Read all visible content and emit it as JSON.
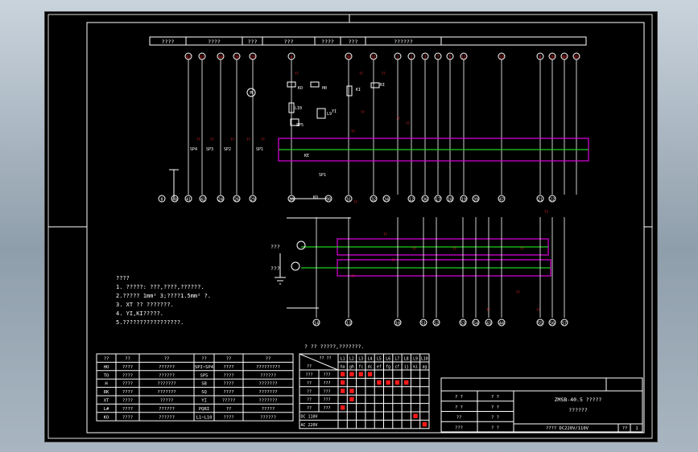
{
  "header_row": [
    "????",
    "????",
    "???",
    "???",
    "????",
    "???",
    "??????"
  ],
  "bus_labels": [
    "42",
    "41",
    "44",
    "26",
    "29",
    "4",
    "30",
    "31",
    "1",
    "2",
    "3",
    "7",
    "5",
    "11",
    "33",
    "6",
    "20",
    "40",
    "45"
  ],
  "terminal_labels": [
    "0",
    "40",
    "41",
    "42",
    "24",
    "26",
    "29",
    "28",
    "30",
    "31",
    "32",
    "34",
    "12",
    "36",
    "17",
    "18",
    "19",
    "39",
    "47",
    "21",
    "22"
  ],
  "bottom_terminals": [
    "14",
    "13",
    "10",
    "51",
    "52",
    "53",
    "54",
    "43",
    "44",
    "55",
    "56",
    "57"
  ],
  "small_labels": {
    "relay_labels": [
      "KO",
      "H0",
      "KI",
      "RI",
      "LI0",
      "L9",
      "SP5",
      "YI",
      "SP4",
      "SP3",
      "SP2",
      "SP1",
      "SP1",
      "KO",
      "KE"
    ],
    "motor": "M",
    "misc_caption": "? ?? ?????,???????.",
    "side_labels": [
      "???",
      "???"
    ]
  },
  "notes": {
    "title": "????",
    "lines": [
      "1. ?????:  ???,????,??????.",
      "2.?????  1mm²  3;????1.5mm²       ?.",
      "3. XT  ??      ???????.",
      "4. YI,KI?????.",
      "5.?????????????????."
    ]
  },
  "legend_table": {
    "header": [
      "??",
      "??",
      "??",
      "??",
      "??",
      "??"
    ],
    "rows": [
      [
        "HO",
        "????",
        "??????",
        "SPI~SP4",
        "????",
        "?????????"
      ],
      [
        "TO",
        "????",
        "??????",
        "SP5",
        "????",
        "??????"
      ],
      [
        "H",
        "????",
        "???????",
        "SB",
        "????",
        "???????"
      ],
      [
        "RK",
        "????",
        "???????",
        "SQ",
        "????",
        "???????"
      ],
      [
        "XT",
        "????",
        "?????",
        "YI",
        "?????",
        "???????"
      ],
      [
        "L#",
        "????",
        "??????",
        "PQRI",
        "??",
        "?????"
      ],
      [
        "KO",
        "????",
        "??????",
        "L1~L10",
        "????",
        "??????"
      ]
    ]
  },
  "state_table": {
    "corner_top": "?? ??",
    "corner_bottom": "??",
    "col_headers": [
      "L1",
      "L2",
      "L3",
      "L4",
      "L5",
      "L6",
      "L7",
      "L8",
      "L9",
      "L10"
    ],
    "col_sub": [
      "ha",
      "gh",
      "fc",
      "dc",
      "ef",
      "fg",
      "cf",
      "ij",
      "ki",
      "ag"
    ],
    "row_labels": [
      [
        "???",
        "???"
      ],
      [
        "??",
        "???"
      ],
      [
        "??",
        "???"
      ],
      [
        "??",
        "???"
      ],
      [
        "??",
        "???"
      ],
      [
        "DC 110V",
        ""
      ],
      [
        "AC 220V",
        ""
      ]
    ],
    "marks": [
      [
        1,
        1,
        1,
        1,
        0,
        0,
        0,
        0,
        0,
        0
      ],
      [
        1,
        0,
        0,
        0,
        1,
        1,
        1,
        1,
        0,
        0
      ],
      [
        1,
        1,
        0,
        0,
        0,
        0,
        0,
        0,
        0,
        0
      ],
      [
        0,
        1,
        0,
        0,
        0,
        0,
        0,
        0,
        0,
        0
      ],
      [
        1,
        0,
        0,
        0,
        0,
        0,
        0,
        0,
        0,
        0
      ],
      [
        0,
        0,
        0,
        0,
        0,
        0,
        0,
        0,
        1,
        0
      ],
      [
        0,
        0,
        0,
        0,
        0,
        0,
        0,
        0,
        0,
        1
      ]
    ]
  },
  "title_block": {
    "drawing_title": "ZMSB-40.5 ?????",
    "subtitle": "??????",
    "left_cells": [
      [
        "? ?",
        "? ?"
      ],
      [
        "? ?",
        "? ?"
      ],
      [
        "??",
        "? ?"
      ],
      [
        "???",
        "? ?"
      ]
    ],
    "bottom_text": "????   DC220V/110V",
    "sheet": "??",
    "sheet_no": "1"
  },
  "colors": {
    "wire": "#ffffff",
    "label": "#ff2a2a",
    "contact_bar": "#e000e0",
    "ground_line": "#1fd01f",
    "state_mark": "#ff1a1a",
    "sheet_bg": "#000000"
  }
}
